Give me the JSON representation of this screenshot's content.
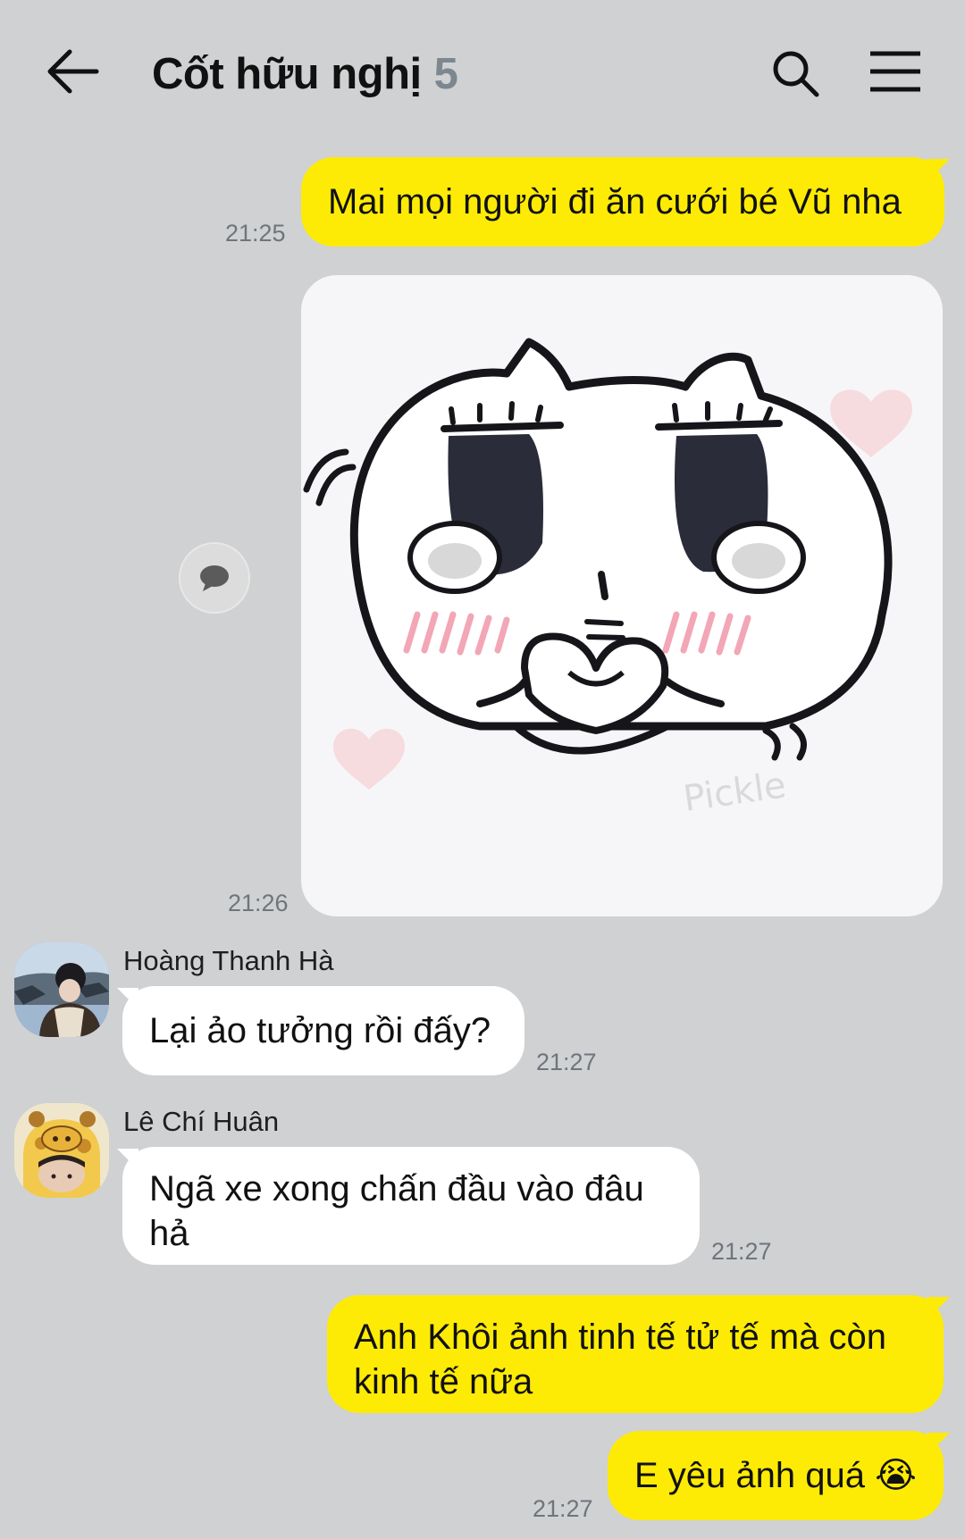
{
  "header": {
    "title": "Cốt hữu nghị",
    "member_count": "5",
    "back_icon": "arrow-left-icon",
    "search_icon": "search-icon",
    "menu_icon": "hamburger-menu-icon"
  },
  "colors": {
    "background": "#cfd1d3",
    "outgoing_bubble": "#fdeb05",
    "incoming_bubble": "#ffffff",
    "time_text": "#6f757b",
    "member_count": "#7d8790"
  },
  "messages": [
    {
      "direction": "out",
      "text": "Mai mọi người đi ăn cưới bé Vũ nha",
      "time": "21:25"
    },
    {
      "direction": "out",
      "type": "sticker",
      "sticker": "cat-heart-hands-sticker",
      "time": "21:26"
    },
    {
      "direction": "in",
      "sender": "Hoàng Thanh Hà",
      "text": "Lại ảo tưởng rồi đấy?",
      "time": "21:27"
    },
    {
      "direction": "in",
      "sender": "Lê Chí Huân",
      "text_lines": [
        "Ngã xe xong chấn đầu vào đâu",
        "hả"
      ],
      "time": "21:27"
    },
    {
      "direction": "out",
      "text_lines": [
        "Anh Khôi ảnh tinh tế tử tế mà còn",
        "kinh tế nữa"
      ]
    },
    {
      "direction": "out",
      "text": "E yêu ảnh quá 😭",
      "time": "21:27"
    }
  ],
  "share_icon": "speech-bubble-icon"
}
